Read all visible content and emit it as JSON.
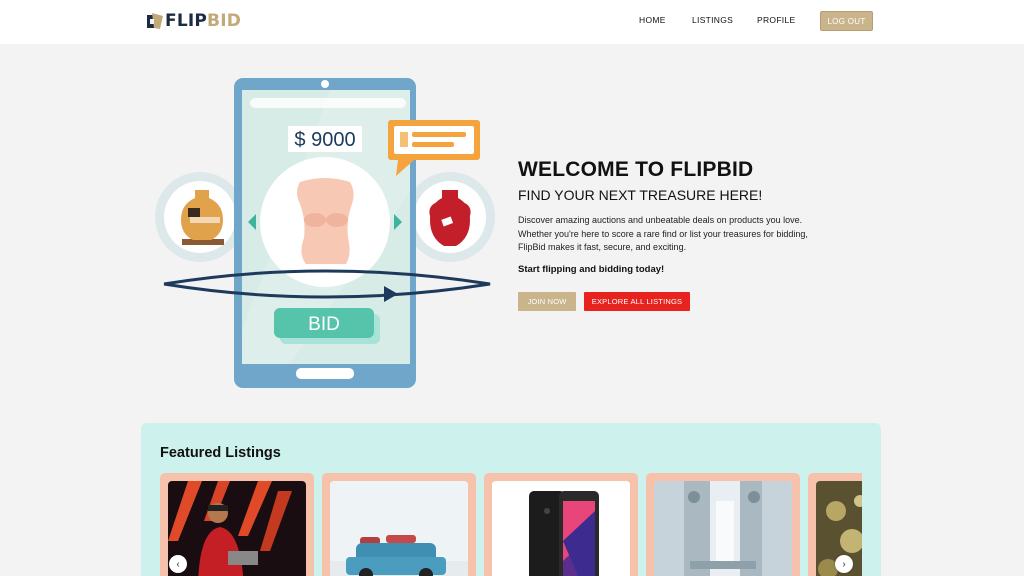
{
  "brand": {
    "part1": "FLIP",
    "part2": "BID"
  },
  "nav": {
    "home": "HOME",
    "listings": "LISTINGS",
    "profile": "PROFILE",
    "logout": "LOG OUT"
  },
  "hero": {
    "illustration": {
      "price": "$ 9000",
      "bid_label": "BID"
    },
    "title": "WELCOME TO FLIPBID",
    "subtitle": "FIND YOUR NEXT TREASURE HERE!",
    "description": "Discover amazing auctions and unbeatable deals on products you love. Whether you're here to score a rare find or list your treasures for bidding, FlipBid makes it fast, secure, and exciting.",
    "cta_text": "Start flipping and bidding today!",
    "join_label": "JOIN NOW",
    "explore_label": "EXPLORE ALL LISTINGS"
  },
  "featured": {
    "title": "Featured Listings",
    "prev_icon": "chevron-left-icon",
    "next_icon": "chevron-right-icon"
  },
  "colors": {
    "accent_gold": "#c9b48c",
    "cta_red": "#e8231f",
    "brand_navy": "#1d2a44",
    "featured_bg": "#cdf1ec",
    "card_bg": "#f6c2ac"
  }
}
